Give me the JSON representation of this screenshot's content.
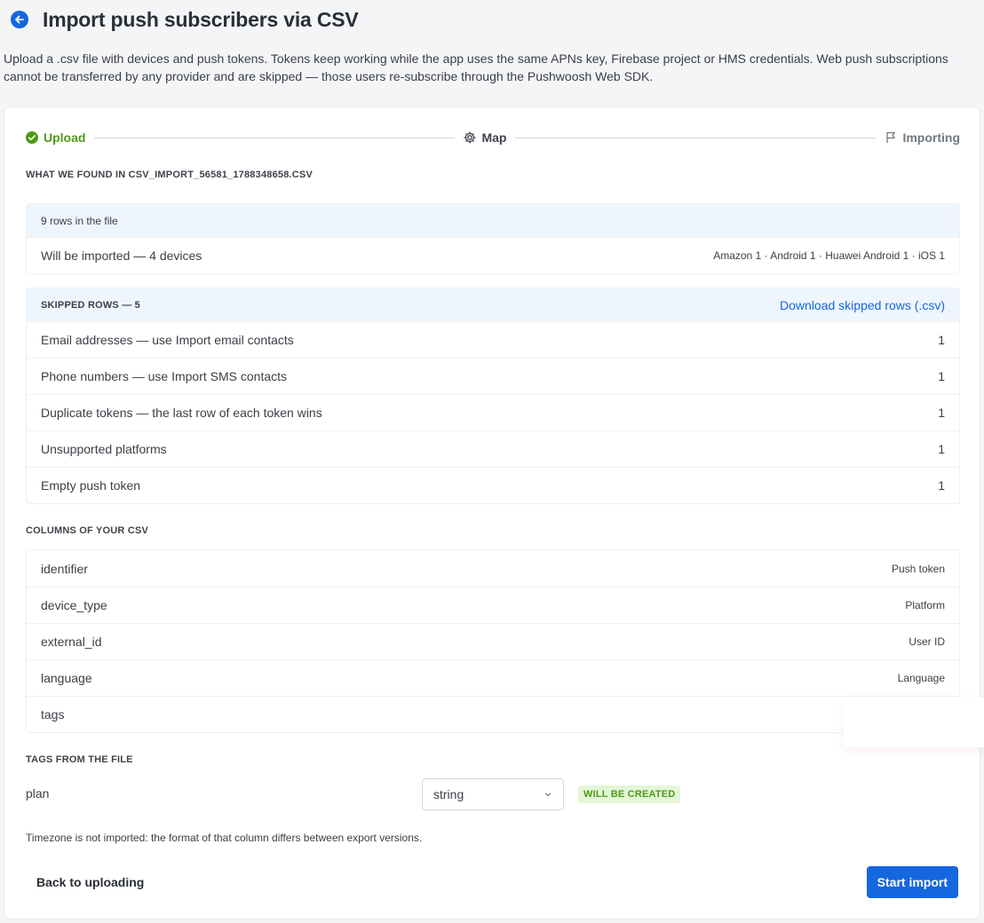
{
  "header": {
    "title": "Import push subscribers via CSV",
    "back_icon": "arrow-left-icon"
  },
  "intro": "Upload a .csv file with devices and push tokens. Tokens keep working while the app uses the same APNs key, Firebase project or HMS credentials. Web push subscriptions cannot be transferred by any provider and are skipped — those users re-subscribe through the Pushwoosh Web SDK.",
  "stepper": {
    "steps": [
      {
        "label": "Upload",
        "state": "done",
        "icon": "check-circle-icon"
      },
      {
        "label": "Map",
        "state": "active",
        "icon": "gear-icon"
      },
      {
        "label": "Importing",
        "state": "pending",
        "icon": "flag-icon"
      }
    ]
  },
  "found": {
    "title": "What we found in csv_import_56581_1788348658.csv",
    "rows_in_file": "9 rows in the file",
    "imported_label": "Will be imported — 4 devices",
    "imported_breakdown": "Amazon 1 · Android 1 · Huawei Android 1 · iOS 1"
  },
  "skipped": {
    "title": "Skipped rows — 5",
    "download_link": "Download skipped rows (.csv)",
    "rows": [
      {
        "label": "Email addresses — use Import email contacts",
        "count": "1"
      },
      {
        "label": "Phone numbers — use Import SMS contacts",
        "count": "1"
      },
      {
        "label": "Duplicate tokens — the last row of each token wins",
        "count": "1"
      },
      {
        "label": "Unsupported platforms",
        "count": "1"
      },
      {
        "label": "Empty push token",
        "count": "1"
      }
    ]
  },
  "columns": {
    "title": "Columns of your CSV",
    "rows": [
      {
        "name": "identifier",
        "mapped": "Push token"
      },
      {
        "name": "device_type",
        "mapped": "Platform"
      },
      {
        "name": "external_id",
        "mapped": "User ID"
      },
      {
        "name": "language",
        "mapped": "Language"
      },
      {
        "name": "tags",
        "mapped": ""
      }
    ]
  },
  "tags": {
    "title": "Tags from the file",
    "items": [
      {
        "name": "plan",
        "type": "string",
        "badge": "WILL BE CREATED"
      }
    ]
  },
  "note": "Timezone is not imported: the format of that column differs between export versions.",
  "actions": {
    "back": "Back to uploading",
    "start": "Start import"
  },
  "colors": {
    "accent": "#1567e0",
    "success": "#4f9a16",
    "panel_head_bg": "#eef5fd"
  }
}
